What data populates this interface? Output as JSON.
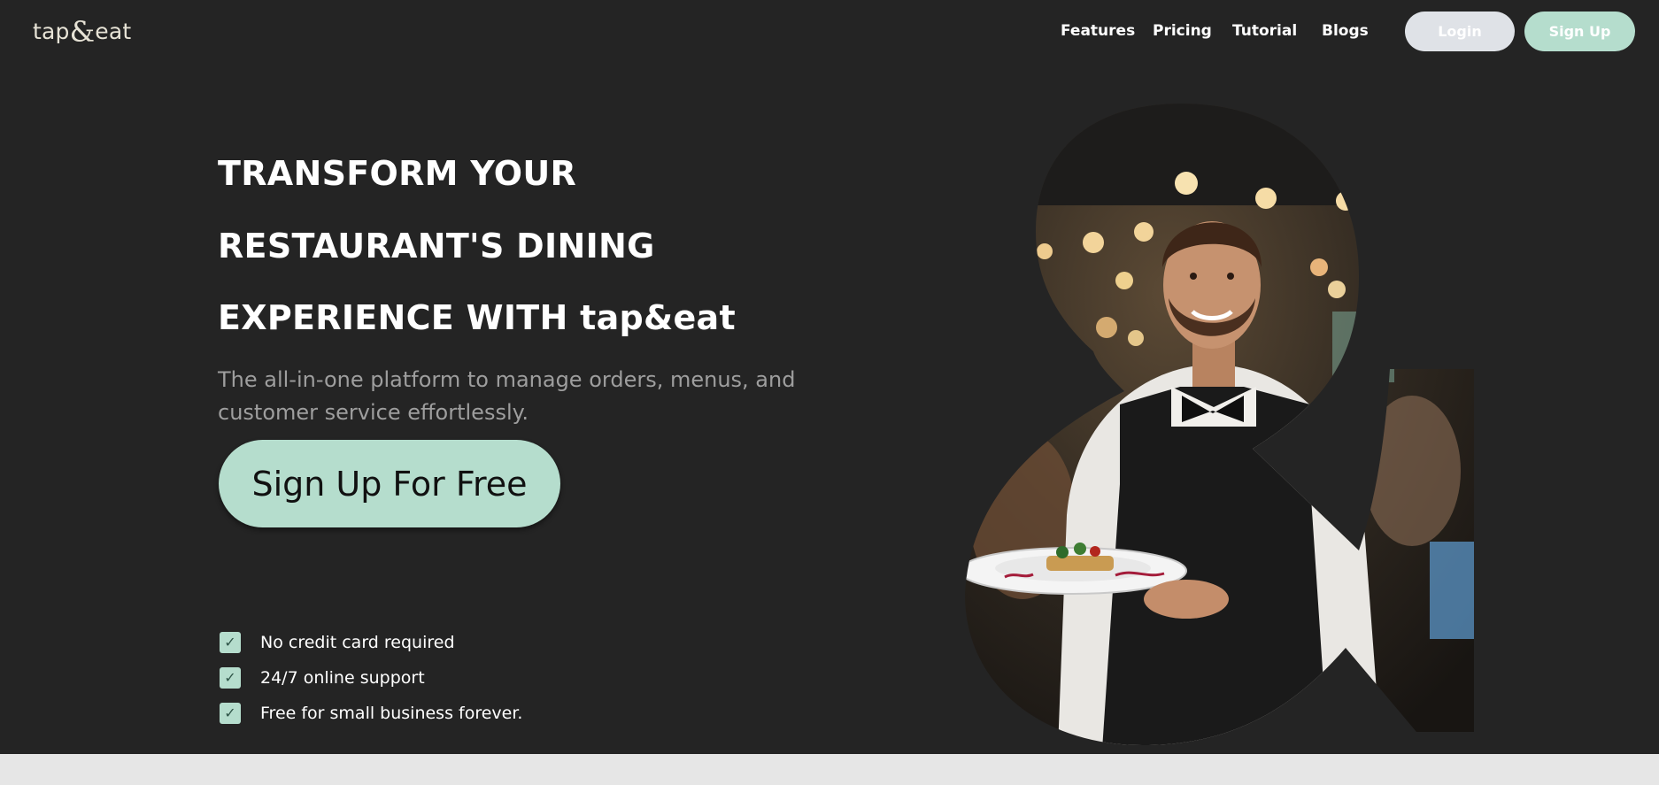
{
  "brand": {
    "prefix": "tap",
    "amp": "&",
    "suffix": "eat"
  },
  "nav": {
    "links": [
      "Features",
      "Pricing",
      "Tutorial",
      "Blogs"
    ],
    "login_label": "Login",
    "signup_label": "Sign Up"
  },
  "hero": {
    "headline_lines": [
      "TRANSFORM YOUR",
      "RESTAURANT'S DINING",
      "EXPERIENCE WITH tap&eat"
    ],
    "subtitle": "The all-in-one platform to manage orders, menus, and customer service effortlessly.",
    "cta_label": "Sign Up For Free",
    "checks": [
      "No credit card required",
      "24/7 online support",
      "Free for small business forever."
    ],
    "image_icon": "waiter-photo-ampersand-shape"
  },
  "colors": {
    "background": "#242424",
    "accent": "#b5ddcd",
    "login_bg": "#dfe2e7",
    "subtitle": "#9e9e9e",
    "footer_strip": "#e6e6e6"
  }
}
